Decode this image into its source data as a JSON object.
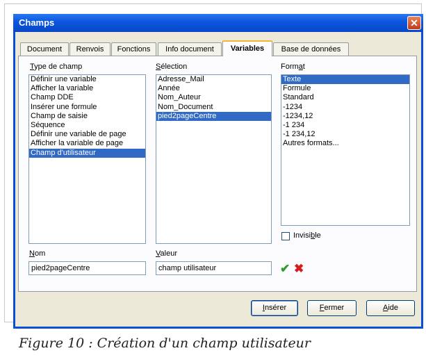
{
  "window": {
    "title": "Champs"
  },
  "tabs": [
    "Document",
    "Renvois",
    "Fonctions",
    "Info document",
    "Variables",
    "Base de données"
  ],
  "labels": {
    "type_prefix": "T",
    "type_rest": "ype de champ",
    "selection_prefix": "S",
    "selection_rest": "élection",
    "format_prefix": "Form",
    "format_u": "a",
    "format_rest": "t",
    "name_prefix": "N",
    "name_rest": "om",
    "value_prefix": "V",
    "value_rest": "aleur",
    "invisible_prefix": "Invisi",
    "invisible_u": "b",
    "invisible_rest": "le"
  },
  "type_list": [
    "Définir une variable",
    "Afficher la variable",
    "Champ DDE",
    "Insérer une formule",
    "Champ de saisie",
    "Séquence",
    "Définir une variable de page",
    "Afficher la variable de page",
    "Champ d'utilisateur"
  ],
  "selection_list": [
    "Adresse_Mail",
    "Année",
    "Nom_Auteur",
    "Nom_Document",
    "pied2pageCentre"
  ],
  "format_list": [
    "Texte",
    "Formule",
    "Standard",
    "-1234",
    "-1234,12",
    "-1 234",
    "-1 234,12",
    "Autres formats..."
  ],
  "fields": {
    "name": "pied2pageCentre",
    "value": "champ utilisateur"
  },
  "buttons": {
    "insert_prefix": "I",
    "insert_rest": "nsérer",
    "close_prefix": "F",
    "close_rest": "ermer",
    "help_prefix": "A",
    "help_rest": "ide"
  },
  "icons": {
    "apply": "check-icon",
    "delete": "cross-icon",
    "close": "close-icon"
  },
  "colors": {
    "title_bar": "#0a55dd",
    "selection": "#316ac5",
    "apply": "#2e9b2e",
    "delete": "#d81c1c"
  },
  "caption": "Figure 10 : Création d'un champ utilisateur"
}
